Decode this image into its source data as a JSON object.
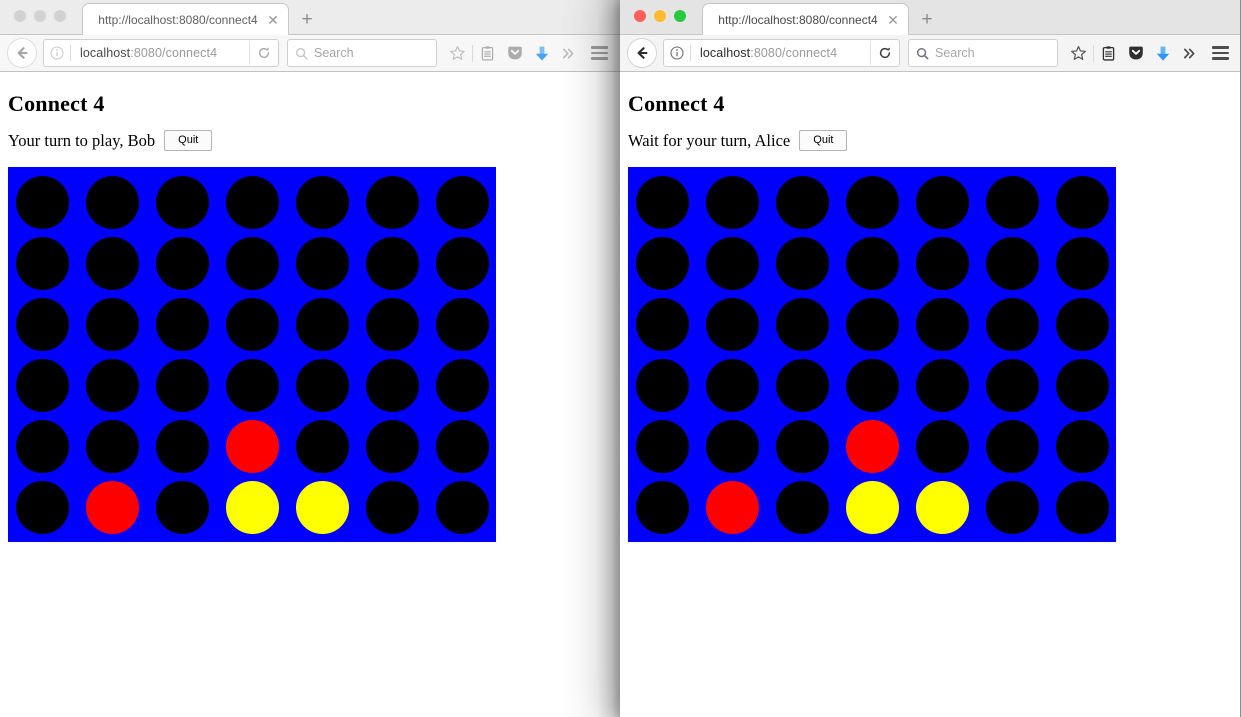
{
  "colors": {
    "board_background": "#0000ff",
    "empty_slot": "#000000",
    "player_red": "#ff0000",
    "player_yellow": "#ffff00",
    "download_icon": "#4aa3f0"
  },
  "windows": [
    {
      "id": "left",
      "focused": false,
      "traffic_lights": [
        "close",
        "minimize",
        "maximize"
      ],
      "tab": {
        "title": "http://localhost:8080/connect4",
        "close_label": "✕"
      },
      "new_tab_label": "+",
      "toolbar": {
        "url_host": "localhost",
        "url_path": ":8080/connect4",
        "search_placeholder": "Search",
        "icons": [
          "bookmark-star-icon",
          "reading-list-icon",
          "pocket-icon",
          "downloads-icon",
          "overflow-chevrons-icon"
        ],
        "overflow_label": "»"
      },
      "page": {
        "title": "Connect 4",
        "status": "Your turn to play, Bob",
        "quit_label": "Quit"
      }
    },
    {
      "id": "right",
      "focused": true,
      "traffic_lights": [
        "close",
        "minimize",
        "maximize"
      ],
      "tab": {
        "title": "http://localhost:8080/connect4",
        "close_label": "✕"
      },
      "new_tab_label": "+",
      "toolbar": {
        "url_host": "localhost",
        "url_path": ":8080/connect4",
        "search_placeholder": "Search",
        "icons": [
          "bookmark-star-icon",
          "reading-list-icon",
          "pocket-icon",
          "downloads-icon",
          "overflow-chevrons-icon"
        ],
        "overflow_label": "»"
      },
      "page": {
        "title": "Connect 4",
        "status": "Wait for your turn, Alice",
        "quit_label": "Quit"
      }
    }
  ],
  "board": {
    "columns": 7,
    "rows": 6,
    "grid": [
      [
        "empty",
        "empty",
        "empty",
        "empty",
        "empty",
        "empty",
        "empty"
      ],
      [
        "empty",
        "empty",
        "empty",
        "empty",
        "empty",
        "empty",
        "empty"
      ],
      [
        "empty",
        "empty",
        "empty",
        "empty",
        "empty",
        "empty",
        "empty"
      ],
      [
        "empty",
        "empty",
        "empty",
        "empty",
        "empty",
        "empty",
        "empty"
      ],
      [
        "empty",
        "empty",
        "empty",
        "red",
        "empty",
        "empty",
        "empty"
      ],
      [
        "empty",
        "red",
        "empty",
        "yellow",
        "yellow",
        "empty",
        "empty"
      ]
    ]
  }
}
